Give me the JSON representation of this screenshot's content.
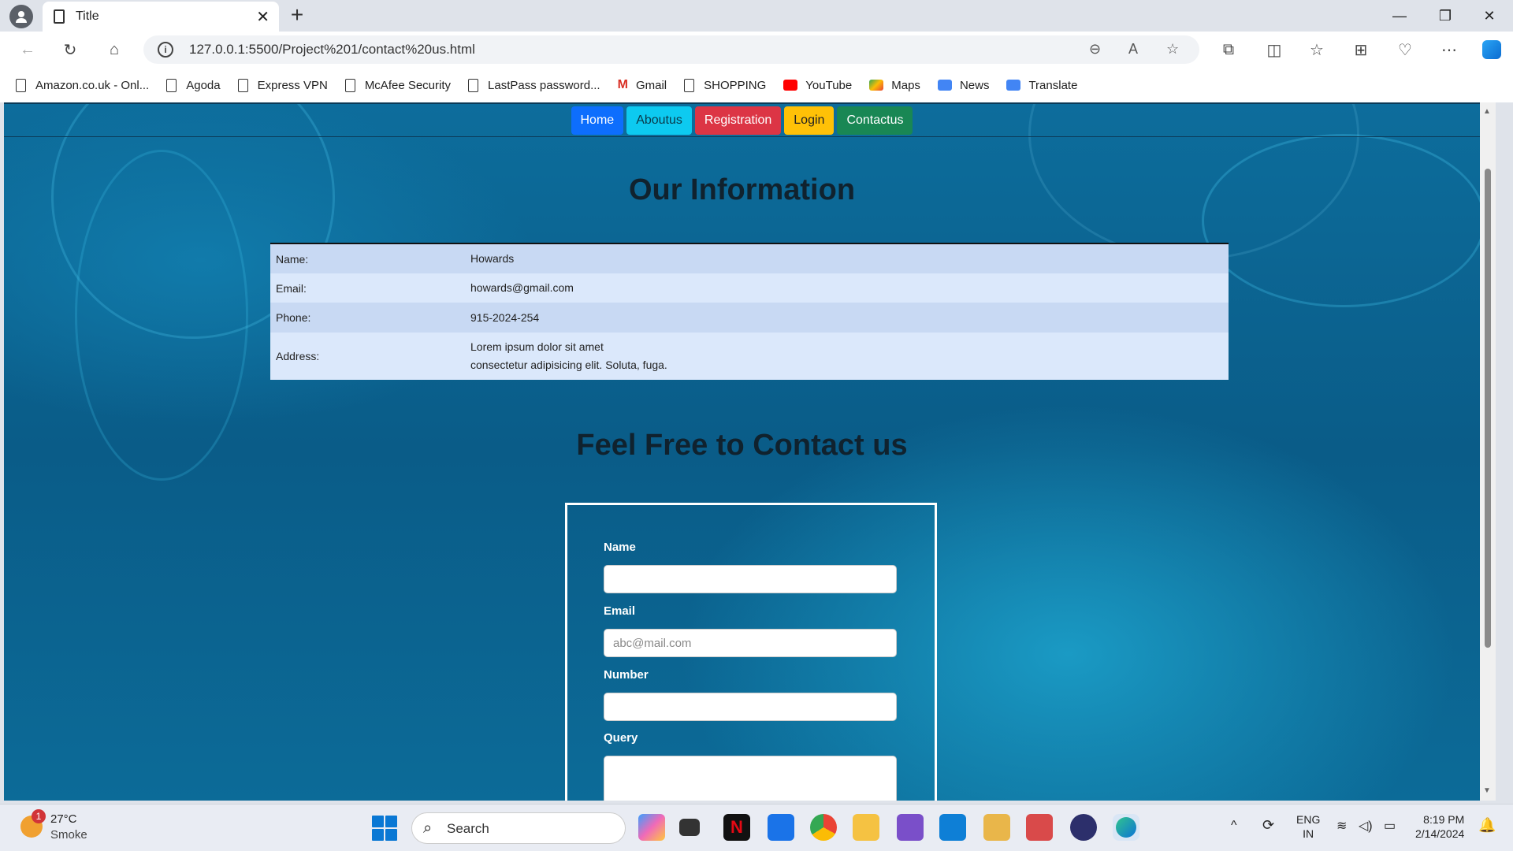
{
  "browser": {
    "tab_title": "Title",
    "url": "127.0.0.1:5500/Project%201/contact%20us.html",
    "bookmarks": [
      {
        "label": "Amazon.co.uk - Onl...",
        "icon": "page-icon"
      },
      {
        "label": "Agoda",
        "icon": "page-icon"
      },
      {
        "label": "Express VPN",
        "icon": "page-icon"
      },
      {
        "label": "McAfee Security",
        "icon": "page-icon"
      },
      {
        "label": "LastPass password...",
        "icon": "page-icon"
      },
      {
        "label": "Gmail",
        "icon": "gmail-icon"
      },
      {
        "label": "SHOPPING",
        "icon": "page-icon"
      },
      {
        "label": "YouTube",
        "icon": "youtube-icon"
      },
      {
        "label": "Maps",
        "icon": "maps-icon"
      },
      {
        "label": "News",
        "icon": "news-icon"
      },
      {
        "label": "Translate",
        "icon": "translate-icon"
      }
    ]
  },
  "page": {
    "nav": {
      "home": "Home",
      "about": "Aboutus",
      "registration": "Registration",
      "login": "Login",
      "contact": "Contactus"
    },
    "info_heading": "Our Information",
    "info": [
      {
        "key": "Name:",
        "value": "Howards"
      },
      {
        "key": "Email:",
        "value": "howards@gmail.com"
      },
      {
        "key": "Phone:",
        "value": "915-2024-254"
      },
      {
        "key": "Address:",
        "value_line1": "Lorem ipsum dolor sit amet",
        "value_line2": "consectetur adipisicing elit. Soluta, fuga."
      }
    ],
    "contact_heading": "Feel Free to Contact us",
    "form": {
      "name_label": "Name",
      "name_value": "",
      "email_label": "Email",
      "email_placeholder": "abc@mail.com",
      "number_label": "Number",
      "number_value": "",
      "query_label": "Query"
    }
  },
  "taskbar": {
    "weather_temp": "27°C",
    "weather_desc": "Smoke",
    "weather_badge": "1",
    "search_label": "Search",
    "lang_line1": "ENG",
    "lang_line2": "IN",
    "time": "8:19 PM",
    "date": "2/14/2024"
  },
  "colors": {
    "home_btn": "#0d6efd",
    "about_btn": "#0dcaf0",
    "registration_btn": "#dc3545",
    "login_btn": "#ffc107",
    "contact_btn": "#198754",
    "page_background": "#0a5c88"
  }
}
